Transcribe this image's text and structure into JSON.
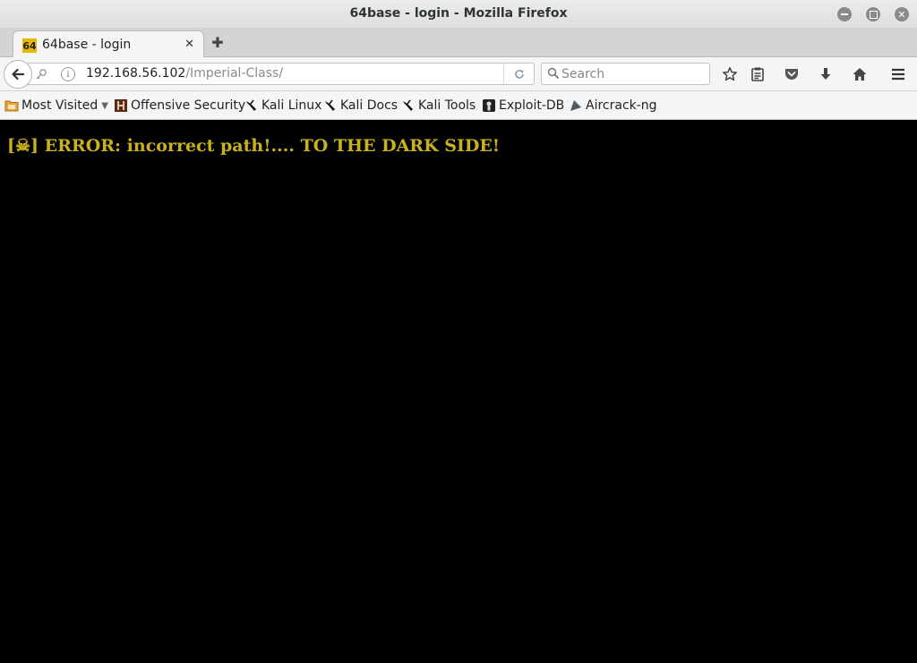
{
  "window": {
    "title": "64base - login - Mozilla Firefox"
  },
  "tab": {
    "favicon_text": "64",
    "label": "64base - login",
    "close": "✕",
    "new_tab": "✚"
  },
  "navbar": {
    "url_host": "192.168.56.102",
    "url_path": "/Imperial-Class/",
    "search_placeholder": "Search"
  },
  "bookmarks": {
    "most_visited": "Most Visited",
    "items": [
      {
        "label": "Offensive Security",
        "icon": "offsec-icon"
      },
      {
        "label": "Kali Linux",
        "icon": "kali-dragon-icon"
      },
      {
        "label": "Kali Docs",
        "icon": "kali-dragon-icon"
      },
      {
        "label": "Kali Tools",
        "icon": "kali-dragon-icon"
      },
      {
        "label": "Exploit-DB",
        "icon": "exploit-db-icon"
      },
      {
        "label": "Aircrack-ng",
        "icon": "aircrack-icon"
      }
    ]
  },
  "page": {
    "error_text": "[☠] ERROR: incorrect path!.... TO THE DARK SIDE!",
    "error_color": "#c9b31a",
    "background": "#000000"
  }
}
